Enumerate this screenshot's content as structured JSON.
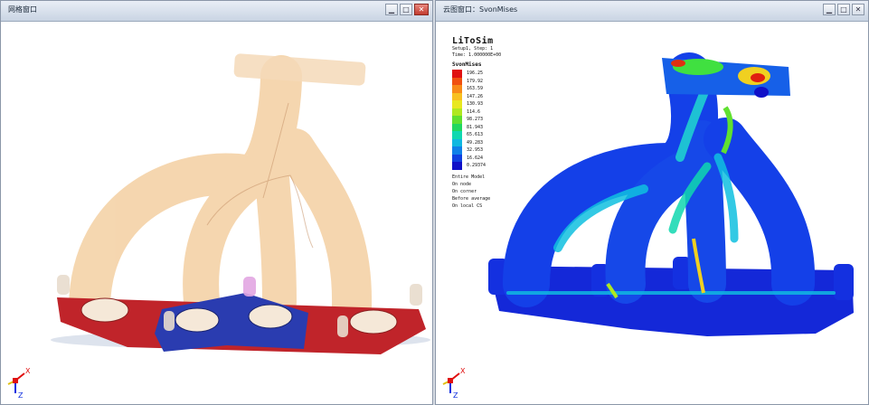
{
  "left_window": {
    "title": "网格窗口"
  },
  "right_window": {
    "title": "云图窗口：SvonMises"
  },
  "window_controls": {
    "minimize": "▁",
    "maximize": "□",
    "close": "✕"
  },
  "triad": {
    "x": "X",
    "z": "Z"
  },
  "legend": {
    "app": "LiToSim",
    "setup_step": "Setup1, Step: 1",
    "time": "Time: 1.000000E+00",
    "variable": "SvonMises",
    "values": [
      "196.25",
      "179.92",
      "163.59",
      "147.26",
      "130.93",
      "114.6",
      "98.273",
      "81.943",
      "65.613",
      "49.283",
      "32.953",
      "16.624",
      "0.29374"
    ],
    "colors": [
      "#e01010",
      "#f05010",
      "#f88a18",
      "#f8c020",
      "#e8e820",
      "#b0e820",
      "#60e030",
      "#20d860",
      "#10d8b0",
      "#10b8e0",
      "#1080e8",
      "#1040e0",
      "#1010c8"
    ],
    "options": [
      "Entire Model",
      "On node",
      "On corner",
      "Before average",
      "On local CS"
    ]
  }
}
